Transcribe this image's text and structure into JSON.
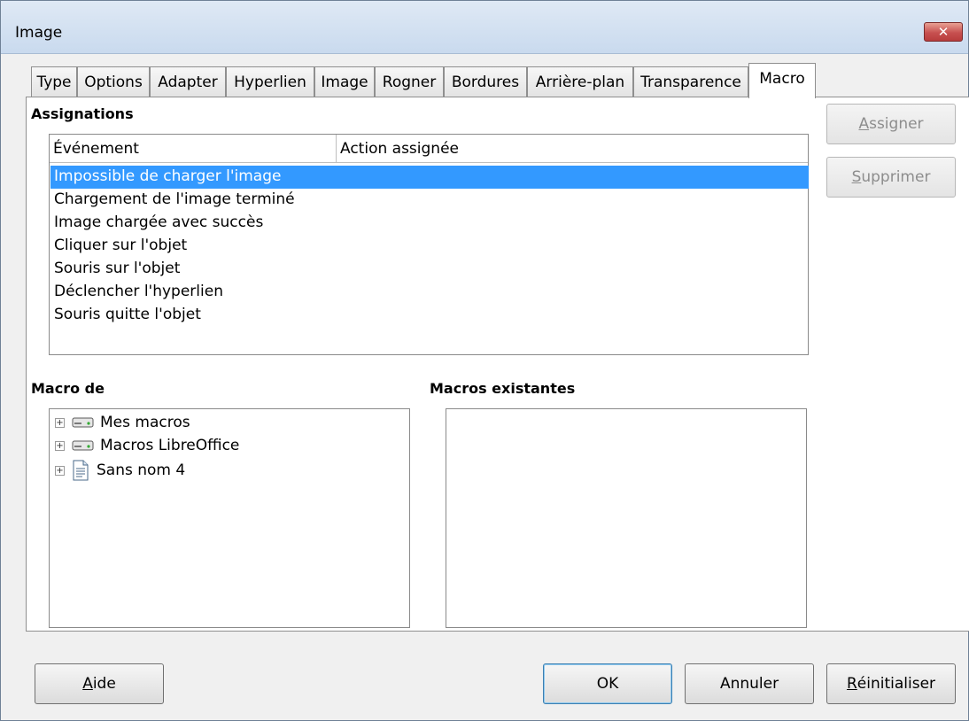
{
  "window": {
    "title": "Image",
    "close_label": "✕"
  },
  "tabs": [
    "Type",
    "Options",
    "Adapter",
    "Hyperlien",
    "Image",
    "Rogner",
    "Bordures",
    "Arrière-plan",
    "Transparence",
    "Macro"
  ],
  "active_tab": "Macro",
  "assignations": {
    "label": "Assignations",
    "col_event": "Événement",
    "col_action": "Action assignée",
    "events": [
      "Impossible de charger l'image",
      "Chargement de l'image terminé",
      "Image chargée avec succès",
      "Cliquer sur l'objet",
      "Souris sur l'objet",
      "Déclencher l'hyperlien",
      "Souris quitte l'objet"
    ],
    "selected_index": 0
  },
  "side_buttons": {
    "assign_mnemonic": "A",
    "assign_rest": "ssigner",
    "delete_mnemonic": "S",
    "delete_rest": "upprimer"
  },
  "macro_from": {
    "label": "Macro de",
    "items": [
      {
        "label": "Mes macros",
        "icon": "drive-icon"
      },
      {
        "label": "Macros LibreOffice",
        "icon": "drive-icon"
      },
      {
        "label": "Sans nom 4",
        "icon": "document-icon"
      }
    ]
  },
  "existing_macros": {
    "label": "Macros existantes"
  },
  "buttons": {
    "help_mnemonic": "A",
    "help_rest": "ide",
    "ok": "OK",
    "cancel": "Annuler",
    "reset_mnemonic": "R",
    "reset_rest": "éinitialiser"
  },
  "colors": {
    "selection": "#3399ff",
    "title_bg": "#c9daee"
  }
}
